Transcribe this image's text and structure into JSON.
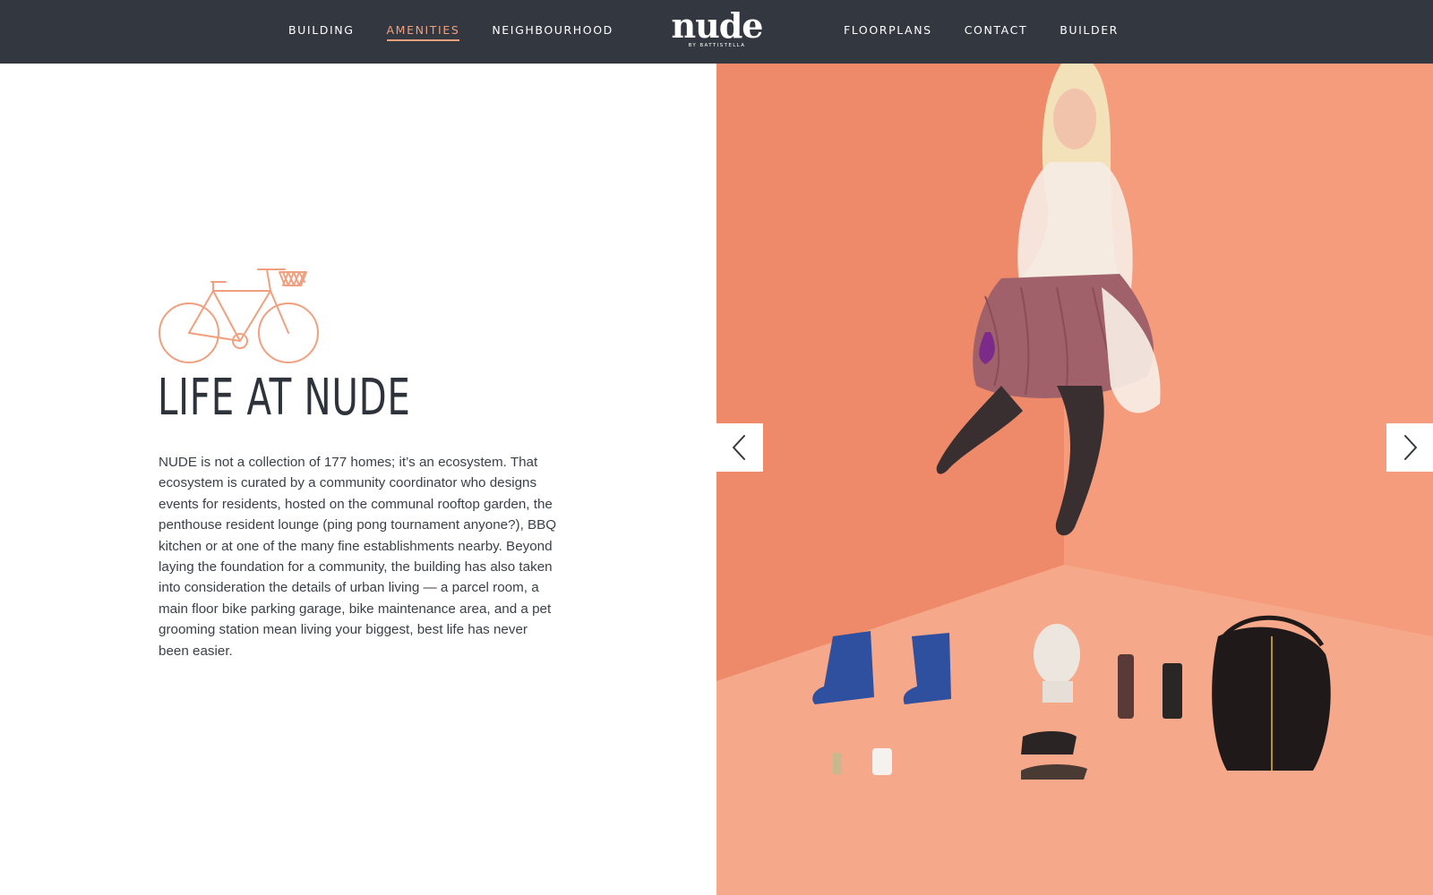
{
  "header": {
    "nav_left": [
      {
        "label": "BUILDING",
        "active": false
      },
      {
        "label": "AMENITIES",
        "active": true
      },
      {
        "label": "NEIGHBOURHOOD",
        "active": false
      }
    ],
    "logo": {
      "word": "nude",
      "sub": "BY BATTISTELLA"
    },
    "nav_right": [
      {
        "label": "FLOORPLANS",
        "active": false
      },
      {
        "label": "CONTACT",
        "active": false
      },
      {
        "label": "BUILDER",
        "active": false
      }
    ]
  },
  "content": {
    "icon": "bicycle-icon",
    "title": "LIFE AT NUDE",
    "body": "NUDE is not a collection of 177 homes; it’s an ecosystem. That ecosystem is curated by a community coordinator who designs events for residents, hosted on the communal rooftop garden, the penthouse resident lounge (ping pong tournament anyone?), BBQ kitchen or at one of the many fine establishments nearby. Beyond laying the foundation for a community, the building has also taken into consideration the details of urban living — a parcel room, a main floor bike parking garage, bike maintenance area, and a pet grooming station mean living your biggest, best life has never been easier."
  },
  "slider": {
    "prev_icon": "chevron-left-icon",
    "next_icon": "chevron-right-icon"
  },
  "colors": {
    "header_bg": "#333840",
    "accent": "#f0a07e",
    "photo_bg": "#f39b7c",
    "title": "#2e323a",
    "body": "#3b3f47"
  }
}
